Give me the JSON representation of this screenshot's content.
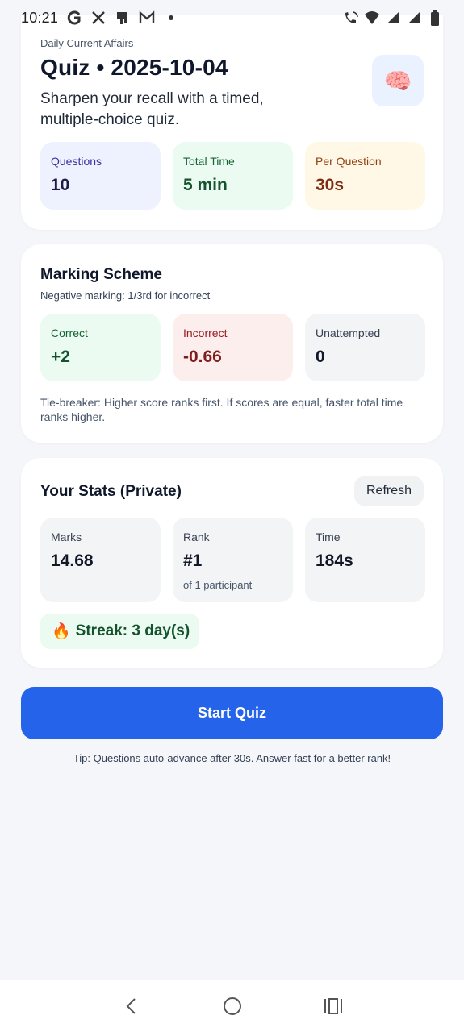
{
  "status_bar": {
    "time": "10:21",
    "left_icons": [
      "google-icon",
      "x-icon",
      "notification-icon",
      "gmail-icon",
      "dot-icon"
    ],
    "right_icons": [
      "wifi-call-icon",
      "wifi-icon",
      "signal-icon",
      "signal-icon",
      "battery-icon"
    ]
  },
  "header": {
    "eyebrow": "Daily Current Affairs",
    "title": "Quiz • 2025-10-04",
    "subtitle": "Sharpen your recall with a timed, multiple-choice quiz.",
    "badge_icon": "🧠"
  },
  "summary": [
    {
      "label": "Questions",
      "value": "10"
    },
    {
      "label": "Total Time",
      "value": "5 min"
    },
    {
      "label": "Per Question",
      "value": "30s"
    }
  ],
  "marking": {
    "title": "Marking Scheme",
    "note": "Negative marking: 1/3rd for incorrect",
    "items": [
      {
        "label": "Correct",
        "value": "+2"
      },
      {
        "label": "Incorrect",
        "value": "-0.66"
      },
      {
        "label": "Unattempted",
        "value": "0"
      }
    ],
    "tiebreak": "Tie-breaker: Higher score ranks first. If scores are equal, faster total time ranks higher."
  },
  "stats": {
    "title": "Your Stats (Private)",
    "refresh_label": "Refresh",
    "marks": {
      "label": "Marks",
      "value": "14.68"
    },
    "rank": {
      "label": "Rank",
      "value": "#1",
      "note": "of 1 participant"
    },
    "time": {
      "label": "Time",
      "value": "184s"
    },
    "streak_icon": "🔥",
    "streak": "Streak: 3 day(s)"
  },
  "actions": {
    "start_label": "Start Quiz",
    "tip": "Tip: Questions auto-advance after 30s. Answer fast for a better rank!"
  },
  "colors": {
    "primary": "#2563eb",
    "background": "#f5f6fa"
  }
}
